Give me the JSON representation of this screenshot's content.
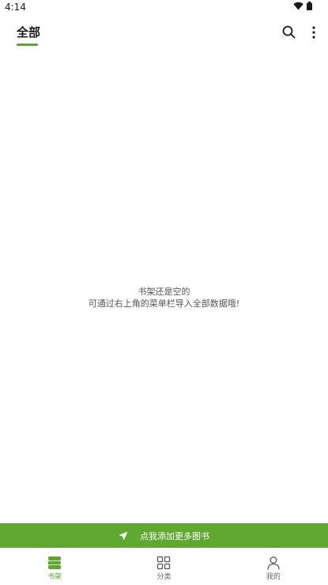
{
  "status_bar": {
    "time": "4:14"
  },
  "app_bar": {
    "tab_label": "全部",
    "search_icon": "search-icon",
    "more_icon": "more-vertical-icon"
  },
  "empty_state": {
    "line1": "书架还是空的",
    "line2": "可通过右上角的菜单栏导入全部数据哦!"
  },
  "import_banner": {
    "icon": "send-icon",
    "label": "点我添加更多图书"
  },
  "bottom_nav": {
    "items": [
      {
        "label": "书架",
        "icon": "bookshelf-icon",
        "active": true
      },
      {
        "label": "分类",
        "icon": "grid-icon",
        "active": false
      },
      {
        "label": "我的",
        "icon": "person-icon",
        "active": false
      }
    ]
  },
  "colors": {
    "accent": "#5fa830",
    "text_primary": "#1a1a1a",
    "text_secondary": "#555555",
    "background": "#ffffff"
  }
}
